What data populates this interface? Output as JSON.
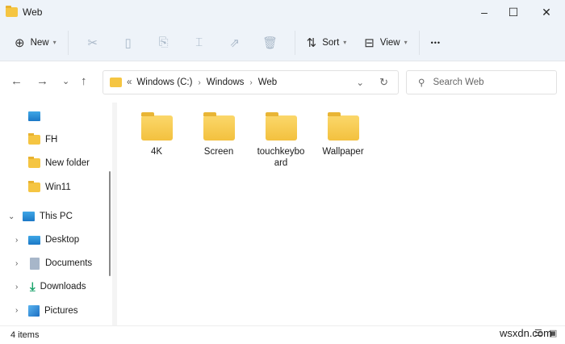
{
  "window": {
    "title": "Web",
    "minimize": "–",
    "maximize": "☐",
    "close": "✕"
  },
  "toolbar": {
    "new_label": "New",
    "sort_label": "Sort",
    "view_label": "View",
    "more": "•••",
    "icons": [
      "plus-circle-icon",
      "cut-icon",
      "copy-icon",
      "paste-icon",
      "rename-icon",
      "share-icon",
      "delete-icon",
      "sort-icon",
      "view-icon",
      "more-icon"
    ]
  },
  "nav": {
    "back": "←",
    "forward": "→",
    "recent": "⌄",
    "up": "↑"
  },
  "address": {
    "overflow": "«",
    "crumbs": [
      "Windows (C:)",
      "Windows",
      "Web"
    ],
    "dropdown": "⌄",
    "refresh": "↻"
  },
  "search": {
    "placeholder": "Search Web",
    "icon": "⚲"
  },
  "sidebar": {
    "quick": [
      {
        "label": ""
      },
      {
        "label": "FH"
      },
      {
        "label": "New folder"
      },
      {
        "label": "Win11"
      }
    ],
    "thispc": {
      "label": "This PC"
    },
    "children": [
      {
        "label": "Desktop",
        "icon": "desktop-icon"
      },
      {
        "label": "Documents",
        "icon": "documents-icon"
      },
      {
        "label": "Downloads",
        "icon": "downloads-icon"
      },
      {
        "label": "Pictures",
        "icon": "pictures-icon"
      }
    ]
  },
  "files": [
    {
      "name": "4K"
    },
    {
      "name": "Screen"
    },
    {
      "name": "touchkeyboard"
    },
    {
      "name": "Wallpaper"
    }
  ],
  "status": {
    "count": "4 items"
  },
  "watermark": "wsxdn.com"
}
